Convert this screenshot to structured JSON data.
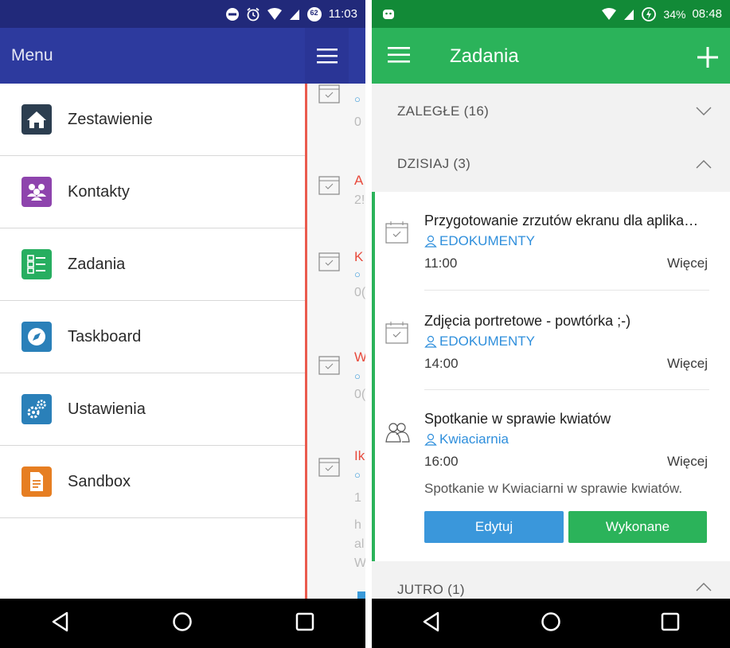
{
  "left_screen": {
    "status": {
      "badge": "62",
      "time": "11:03"
    },
    "menu_title": "Menu",
    "menu_items": [
      {
        "label": "Zestawienie",
        "icon": "home-icon",
        "color": "#2c3e50"
      },
      {
        "label": "Kontakty",
        "icon": "people-icon",
        "color": "#8e44ad"
      },
      {
        "label": "Zadania",
        "icon": "tasks-list-icon",
        "color": "#27ae60"
      },
      {
        "label": "Taskboard",
        "icon": "compass-icon",
        "color": "#2a80b9"
      },
      {
        "label": "Ustawienia",
        "icon": "gears-icon",
        "color": "#2a80b9"
      },
      {
        "label": "Sandbox",
        "icon": "document-icon",
        "color": "#e67e22"
      }
    ],
    "peek_letters": [
      "A",
      "K",
      "W",
      "Ik"
    ],
    "peek_numbers": [
      "0",
      "2!",
      "0(",
      "0(",
      "1",
      "h",
      "al",
      "W"
    ]
  },
  "right_screen": {
    "status": {
      "battery": "34%",
      "time": "08:48"
    },
    "title": "Zadania",
    "sections": [
      {
        "label": "ZALEGŁE (16)",
        "state": "collapsed"
      },
      {
        "label": "DZISIAJ (3)",
        "state": "expanded"
      },
      {
        "label": "JUTRO (1)",
        "state": "expanded"
      }
    ],
    "tasks": [
      {
        "title": "Przygotowanie zrzutów ekranu dla aplika…",
        "contact": "EDOKUMENTY",
        "time": "11:00",
        "more": "Więcej",
        "icon": "calendar-check-icon"
      },
      {
        "title": "Zdjęcia portretowe - powtórka ;-)",
        "contact": "EDOKUMENTY",
        "time": "14:00",
        "more": "Więcej",
        "icon": "calendar-check-icon"
      },
      {
        "title": "Spotkanie w sprawie kwiatów",
        "contact": "Kwiaciarnia",
        "time": "16:00",
        "more": "Więcej",
        "description": "Spotkanie w Kwiaciarni w sprawie kwiatów.",
        "icon": "meeting-icon"
      }
    ],
    "buttons": {
      "edit": "Edytuj",
      "done": "Wykonane"
    },
    "colors": {
      "accent_green": "#2bb35a",
      "edit_blue": "#3a97db",
      "link_blue": "#2f8fdc"
    }
  }
}
